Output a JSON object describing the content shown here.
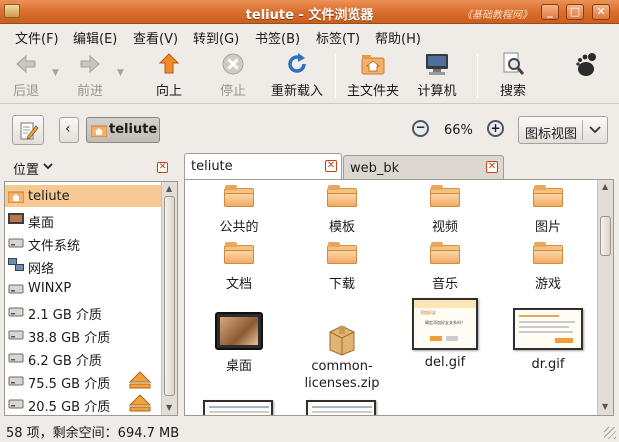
{
  "window": {
    "title": "teliute - 文件浏览器",
    "watermark": "《基础教程网》",
    "minimize_glyph": "_",
    "maximize_glyph": "□",
    "close_glyph": "✕"
  },
  "menubar": [
    "文件(F)",
    "编辑(E)",
    "查看(V)",
    "转到(G)",
    "书签(B)",
    "标签(T)",
    "帮助(H)"
  ],
  "toolbar": {
    "back": "后退",
    "forward": "前进",
    "up": "向上",
    "stop": "停止",
    "reload": "重新载入",
    "home": "主文件夹",
    "computer": "计算机",
    "search": "搜索"
  },
  "locationbar": {
    "crumb": "teliute",
    "zoom": "66%",
    "view_mode": "图标视图",
    "zoom_out_glyph": "−",
    "zoom_in_glyph": "+"
  },
  "sidebar": {
    "header": "位置",
    "items": [
      {
        "label": "teliute",
        "icon": "home-folder-icon",
        "selected": true
      },
      {
        "label": "桌面",
        "icon": "desktop-icon"
      },
      {
        "label": "文件系统",
        "icon": "drive-icon"
      },
      {
        "label": "网络",
        "icon": "network-icon"
      },
      {
        "label": "WINXP",
        "icon": "drive-icon"
      },
      {
        "label": "2.1 GB 介质",
        "icon": "drive-icon"
      },
      {
        "label": "38.8 GB 介质",
        "icon": "drive-icon"
      },
      {
        "label": "6.2 GB 介质",
        "icon": "drive-icon"
      },
      {
        "label": "75.5 GB 介质",
        "icon": "drive-icon",
        "eject": true
      },
      {
        "label": "20.5 GB 介质",
        "icon": "drive-icon",
        "eject": true
      }
    ]
  },
  "tabs": [
    {
      "label": "teliute",
      "active": true
    },
    {
      "label": "web_bk",
      "active": false
    }
  ],
  "files": [
    {
      "name": "公共的",
      "type": "folder"
    },
    {
      "name": "模板",
      "type": "folder"
    },
    {
      "name": "视频",
      "type": "folder"
    },
    {
      "name": "图片",
      "type": "folder"
    },
    {
      "name": "文档",
      "type": "folder"
    },
    {
      "name": "下载",
      "type": "folder"
    },
    {
      "name": "音乐",
      "type": "folder"
    },
    {
      "name": "游戏",
      "type": "folder"
    },
    {
      "name": "桌面",
      "type": "desktop"
    },
    {
      "name": "common-licenses.zip",
      "type": "zip",
      "display": [
        "common-",
        "licenses.zip"
      ]
    },
    {
      "name": "del.gif",
      "type": "image"
    },
    {
      "name": "dr.gif",
      "type": "image"
    }
  ],
  "thumb_text": {
    "del_title": "添加好友",
    "del_body": "确定添加好友关系吗？"
  },
  "statusbar": {
    "text": "58 项，剩余空间：694.7 MB"
  },
  "colors": {
    "titlebar": "#d86c2c",
    "selection": "#f6c892",
    "folder": "#f6c27f",
    "close_accent": "#c0431c"
  }
}
